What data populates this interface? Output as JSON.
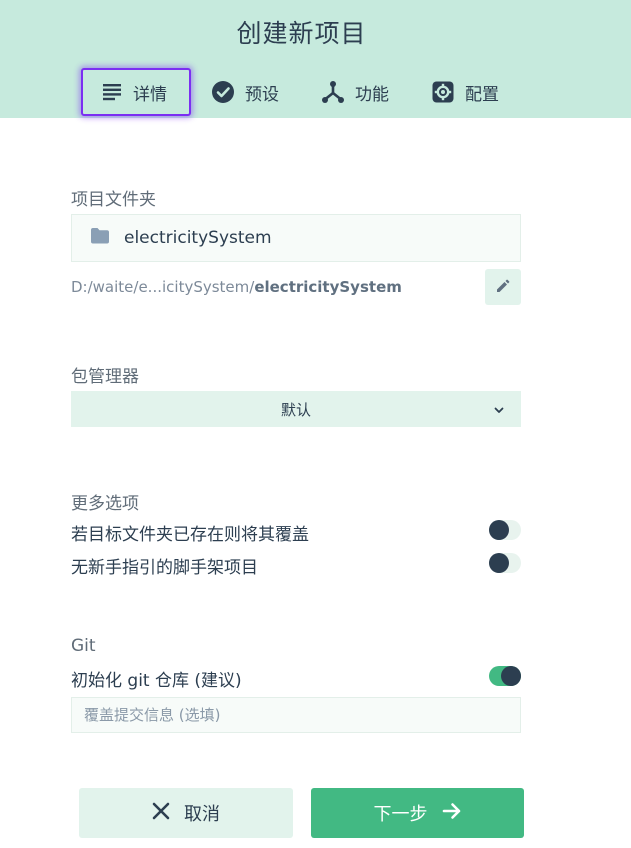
{
  "header": {
    "title": "创建新项目",
    "tabs": [
      {
        "label": "详情",
        "icon": "list-icon",
        "active": true
      },
      {
        "label": "预设",
        "icon": "check-circle-icon",
        "active": false
      },
      {
        "label": "功能",
        "icon": "fork-icon",
        "active": false
      },
      {
        "label": "配置",
        "icon": "gear-icon",
        "active": false
      }
    ]
  },
  "folder": {
    "label": "项目文件夹",
    "name": "electricitySystem",
    "path_prefix": "D:/waite/e...icitySystem/",
    "path_bold": "electricitySystem"
  },
  "package_manager": {
    "label": "包管理器",
    "selected": "默认"
  },
  "more_options": {
    "label": "更多选项",
    "overwrite": {
      "label": "若目标文件夹已存在则将其覆盖",
      "enabled": false
    },
    "no_guide": {
      "label": "无新手指引的脚手架项目",
      "enabled": false
    }
  },
  "git": {
    "label": "Git",
    "init": {
      "label": "初始化 git 仓库 (建议)",
      "enabled": true
    },
    "commit_placeholder": "覆盖提交信息 (选填)"
  },
  "footer": {
    "cancel_label": "取消",
    "next_label": "下一步"
  },
  "colors": {
    "header_bg": "#c6eadd",
    "accent": "#42b983",
    "active_tab_border": "#7b2ff2",
    "text": "#2c3e50"
  }
}
